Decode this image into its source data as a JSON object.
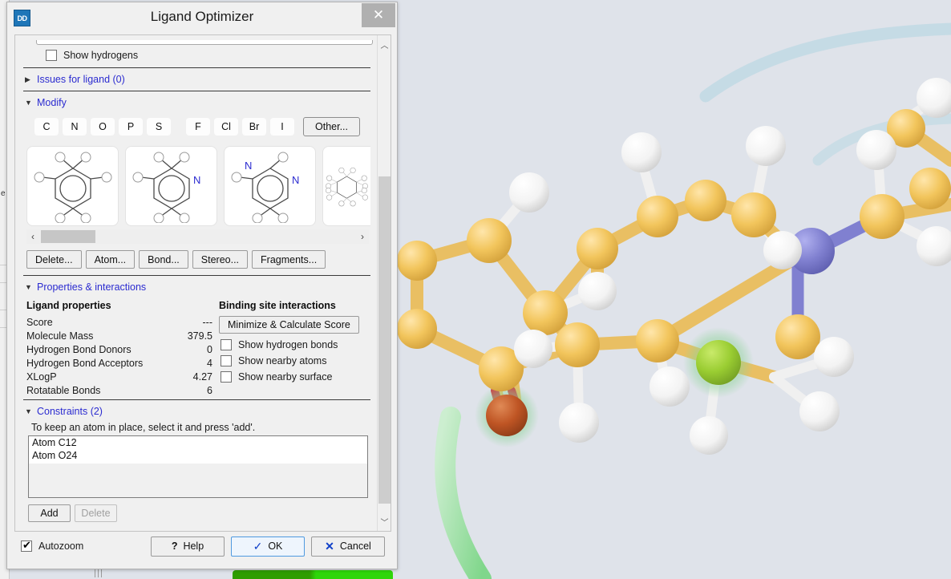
{
  "window": {
    "title": "Ligand Optimizer",
    "icon_label": "DD",
    "close_label": "✕"
  },
  "sections": {
    "show_hydrogens": {
      "label": "Show hydrogens",
      "checked": false
    },
    "issues": {
      "label": "Issues for ligand (0)",
      "expanded": false,
      "triangle": "▶"
    },
    "modify": {
      "label": "Modify",
      "expanded": true,
      "triangle": "▼"
    },
    "properties": {
      "label": "Properties & interactions",
      "expanded": true,
      "triangle": "▼"
    },
    "constraints": {
      "label": "Constraints (2)",
      "expanded": true,
      "triangle": "▼"
    }
  },
  "modify": {
    "elements_primary": [
      "C",
      "N",
      "O",
      "P",
      "S"
    ],
    "elements_halogen": [
      "F",
      "Cl",
      "Br",
      "I"
    ],
    "other_label": "Other...",
    "fragments": [
      {
        "name": "benzene",
        "hetero": []
      },
      {
        "name": "pyridine",
        "hetero": [
          "N"
        ]
      },
      {
        "name": "pyrimidine",
        "hetero": [
          "N",
          "N"
        ]
      },
      {
        "name": "cyclohexane",
        "hetero": []
      }
    ],
    "scroll_left": "‹",
    "scroll_right": "›",
    "tools": [
      "Delete...",
      "Atom...",
      "Bond...",
      "Stereo...",
      "Fragments..."
    ]
  },
  "properties": {
    "ligand_heading": "Ligand properties",
    "rows": [
      {
        "name": "Score",
        "value": "---"
      },
      {
        "name": "Molecule Mass",
        "value": "379.5"
      },
      {
        "name": "Hydrogen Bond Donors",
        "value": "0"
      },
      {
        "name": "Hydrogen Bond Acceptors",
        "value": "4"
      },
      {
        "name": "XLogP",
        "value": "4.27"
      },
      {
        "name": "Rotatable Bonds",
        "value": "6"
      }
    ],
    "binding_heading": "Binding site interactions",
    "minimize_label": "Minimize & Calculate Score",
    "checkboxes": [
      {
        "label": "Show hydrogen bonds",
        "checked": false
      },
      {
        "label": "Show nearby atoms",
        "checked": false
      },
      {
        "label": "Show nearby surface",
        "checked": false
      }
    ]
  },
  "constraints": {
    "hint": "To keep an atom in place, select it and press 'add'.",
    "items": [
      "Atom C12",
      "Atom O24"
    ],
    "add_label": "Add",
    "delete_label": "Delete"
  },
  "footer": {
    "autozoom_label": "Autozoom",
    "autozoom_checked": true,
    "help_label": "Help",
    "help_glyph": "?",
    "ok_label": "OK",
    "ok_glyph": "✓",
    "cancel_label": "Cancel",
    "cancel_glyph": "✕"
  },
  "viewer": {
    "background_color": "#dfe3ea",
    "carbon_color": "#f2c55c",
    "hydrogen_color": "#f4f4f4",
    "nitrogen_color": "#8080d0",
    "oxygen_color": "#bf5524",
    "constraint_highlight_color": "#8fd49a",
    "ribbon_green_color": "#9fe3a4",
    "ribbon_blue_color": "#bcd8e3",
    "selected_carbon_color": "#9acd32"
  },
  "background_app": {
    "edge_text": "e"
  }
}
